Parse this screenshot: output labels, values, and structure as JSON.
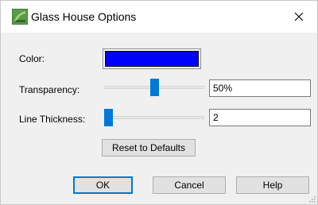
{
  "window": {
    "title": "Glass House Options",
    "icon": "glass-house-app-icon",
    "close_icon": "close-icon"
  },
  "color": {
    "label": "Color:",
    "value": "#0000ff"
  },
  "transparency": {
    "label": "Transparency:",
    "slider_value": 0.5,
    "field_value": "50%"
  },
  "line_thickness": {
    "label": "Line Thickness:",
    "slider_value": 0.0,
    "field_value": "2"
  },
  "buttons": {
    "reset": "Reset to Defaults",
    "ok": "OK",
    "cancel": "Cancel",
    "help": "Help"
  },
  "colors": {
    "accent": "#0078d7",
    "dialog_bg": "#f0f0f0"
  }
}
